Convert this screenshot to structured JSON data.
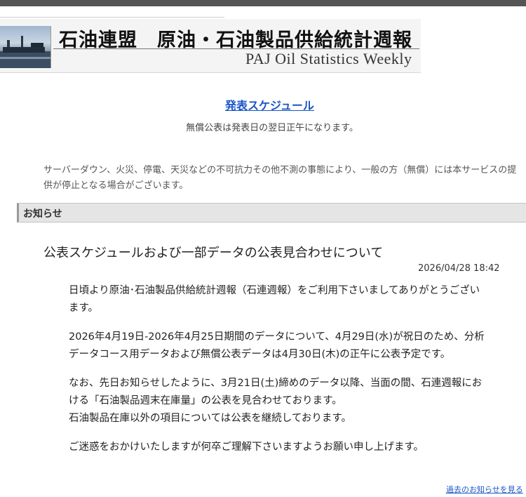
{
  "header": {
    "title": "石油連盟　原油・石油製品供給統計週報",
    "subtitle": "PAJ Oil Statistics Weekly"
  },
  "schedule": {
    "link_label": "発表スケジュール",
    "note": "無償公表は発表日の翌日正午になります。"
  },
  "disclaimer": "サーバーダウン、火災、停電、天災などの不可抗力その他不測の事態により、一般の方（無償）には本サービスの提供が停止となる場合がございます。",
  "notice": {
    "section_label": "お知らせ",
    "title": "公表スケジュールおよび一部データの公表見合わせについて",
    "date": "2026/04/28 18:42",
    "paragraphs": [
      "日頃より原油･石油製品供給統計週報（石連週報）をご利用下さいましてありがとうございます。",
      "2026年4月19日-2026年4月25日期間のデータについて、4月29日(水)が祝日のため、分析データコース用データおよび無償公表データは4月30日(木)の正午に公表予定です。",
      "なお、先日お知らせしたように、3月21日(土)締めのデータ以降、当面の間、石連週報における「石油製品週末在庫量」の公表を見合わせております。",
      "石油製品在庫以外の項目については公表を継続しております。",
      "ご迷惑をおかけいたしますが何卒ご理解下さいますようお願い申し上げます。"
    ],
    "past_link": "過去のお知らせを見る"
  },
  "colors": {
    "link": "#1a55c7",
    "section_bar": "#e5e5e5"
  }
}
